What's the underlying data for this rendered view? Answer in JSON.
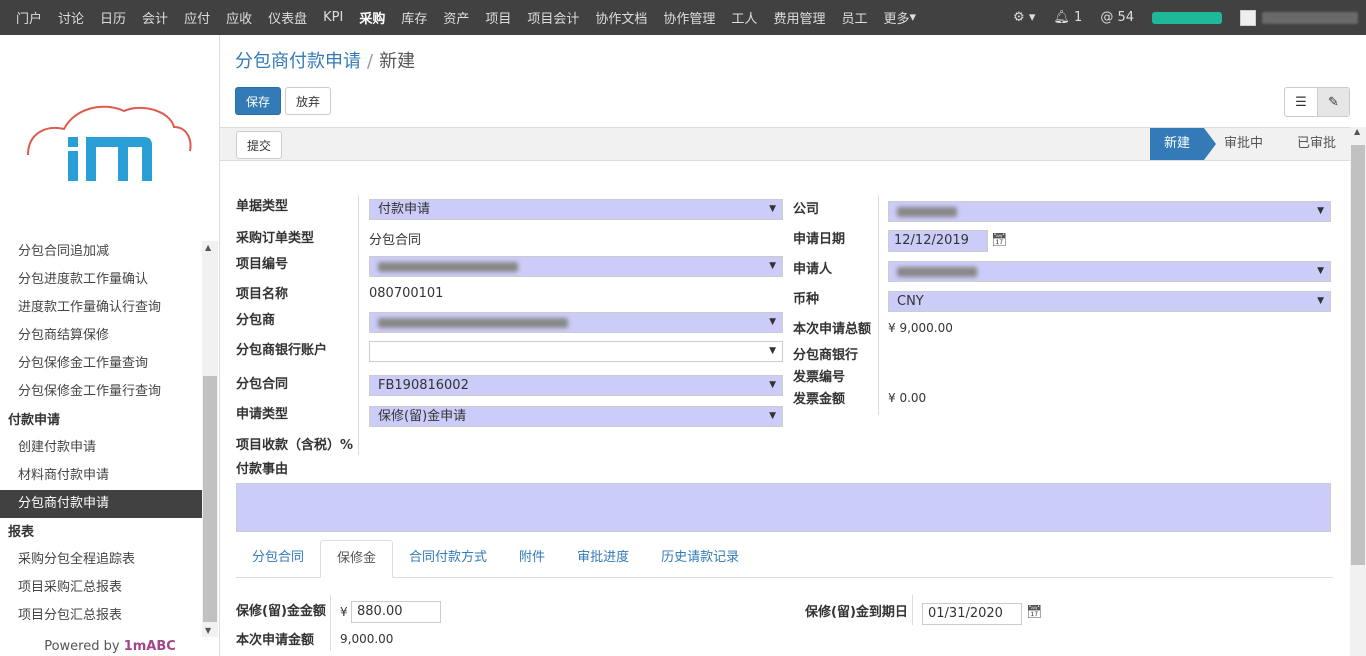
{
  "topbar": {
    "menu": [
      "门户",
      "讨论",
      "日历",
      "会计",
      "应付",
      "应收",
      "仪表盘",
      "KPI",
      "采购",
      "库存",
      "资产",
      "项目",
      "项目会计",
      "协作文档",
      "协作管理",
      "工人",
      "费用管理",
      "员工",
      "更多"
    ],
    "active": "采购",
    "settings_icon": "gear-icon",
    "bell_count": "1",
    "at_count": "54",
    "progress_color": "#1fb89a"
  },
  "sidebar": {
    "items": [
      {
        "type": "item",
        "label": "分包合同追加减"
      },
      {
        "type": "item",
        "label": "分包进度款工作量确认"
      },
      {
        "type": "item",
        "label": "进度款工作量确认行查询"
      },
      {
        "type": "item",
        "label": "分包商结算保修"
      },
      {
        "type": "item",
        "label": "分包保修金工作量查询"
      },
      {
        "type": "item",
        "label": "分包保修金工作量行查询"
      },
      {
        "type": "head",
        "label": "付款申请"
      },
      {
        "type": "item",
        "label": "创建付款申请"
      },
      {
        "type": "item",
        "label": "材料商付款申请"
      },
      {
        "type": "item",
        "label": "分包商付款申请",
        "active": true
      },
      {
        "type": "head",
        "label": "报表"
      },
      {
        "type": "item",
        "label": "采购分包全程追踪表"
      },
      {
        "type": "item",
        "label": "项目采购汇总报表"
      },
      {
        "type": "item",
        "label": "项目分包汇总报表"
      }
    ],
    "powered_prefix": "Powered by ",
    "powered_brand": "1mABC"
  },
  "breadcrumb": {
    "parent": "分包商付款申请",
    "sep": "/",
    "current": "新建"
  },
  "buttons": {
    "save": "保存",
    "discard": "放弃",
    "submit": "提交"
  },
  "stages": [
    "新建",
    "审批中",
    "已审批"
  ],
  "form": {
    "doc_type_label": "单据类型",
    "doc_type_value": "付款申请",
    "po_type_label": "采购订单类型",
    "po_type_value": "分包合同",
    "project_no_label": "项目编号",
    "project_name_label": "项目名称",
    "project_name_value": "080700101",
    "subcontractor_label": "分包商",
    "bank_label": "分包商银行账户",
    "contract_label": "分包合同",
    "contract_value": "FB190816002",
    "apply_type_label": "申请类型",
    "apply_type_value": "保修(留)金申请",
    "receipt_label": "项目收款（含税）%",
    "reason_label": "付款事由",
    "company_label": "公司",
    "date_label": "申请日期",
    "date_value": "12/12/2019",
    "applicant_label": "申请人",
    "currency_label": "币种",
    "currency_value": "CNY",
    "total_label": "本次申请总额",
    "total_value": "¥ 9,000.00",
    "bank2_label": "分包商银行",
    "invoice_no_label": "发票编号",
    "invoice_amt_label": "发票金额",
    "invoice_amt_value": "¥ 0.00"
  },
  "tabs": [
    "分包合同",
    "保修金",
    "合同付款方式",
    "附件",
    "审批进度",
    "历史请款记录"
  ],
  "active_tab": "保修金",
  "warranty": {
    "amount_label": "保修(留)金金额",
    "currency_sym": "¥",
    "amount_value": "880.00",
    "current_label": "本次申请金额",
    "current_value": "9,000.00",
    "due_label": "保修(留)金到期日",
    "due_value": "01/31/2020"
  }
}
